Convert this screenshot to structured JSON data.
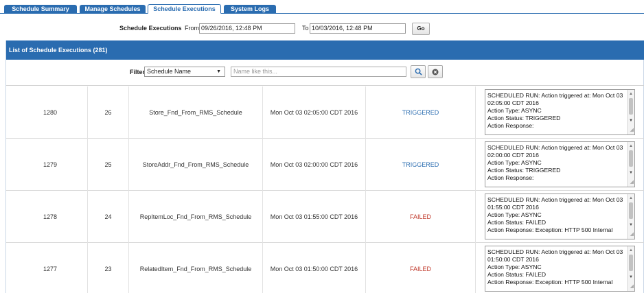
{
  "tabs": [
    {
      "label": "Schedule Summary"
    },
    {
      "label": "Manage Schedules"
    },
    {
      "label": "Schedule Executions"
    },
    {
      "label": "System Logs"
    }
  ],
  "executions": {
    "label": "Schedule Executions",
    "from_label": "From",
    "from_value": "09/26/2016, 12:48 PM",
    "to_label": "To",
    "to_value": "10/03/2016, 12:48 PM",
    "go_label": "Go"
  },
  "panel": {
    "title": "List of Schedule Executions (281)"
  },
  "filter": {
    "label": "Filter",
    "selected": "Schedule Name",
    "placeholder": "Name like this...",
    "search_icon": "search-icon",
    "clear_icon": "clear-icon"
  },
  "rows": [
    {
      "id": "1280",
      "schedule_id": "26",
      "name": "Store_Fnd_From_RMS_Schedule",
      "time": "Mon Oct 03 02:05:00 CDT 2016",
      "status": "TRIGGERED",
      "log": [
        "SCHEDULED RUN: Action triggered at: Mon Oct 03 02:05:00 CDT 2016",
        "Action Type: ASYNC",
        "Action Status: TRIGGERED",
        "Action Response:"
      ]
    },
    {
      "id": "1279",
      "schedule_id": "25",
      "name": "StoreAddr_Fnd_From_RMS_Schedule",
      "time": "Mon Oct 03 02:00:00 CDT 2016",
      "status": "TRIGGERED",
      "log": [
        "SCHEDULED RUN: Action triggered at: Mon Oct 03 02:00:00 CDT 2016",
        "Action Type: ASYNC",
        "Action Status: TRIGGERED",
        "Action Response:"
      ]
    },
    {
      "id": "1278",
      "schedule_id": "24",
      "name": "RepItemLoc_Fnd_From_RMS_Schedule",
      "time": "Mon Oct 03 01:55:00 CDT 2016",
      "status": "FAILED",
      "log": [
        "SCHEDULED RUN: Action triggered at: Mon Oct 03 01:55:00 CDT 2016",
        "Action Type: ASYNC",
        "Action Status: FAILED",
        "Action Response: Exception: HTTP 500 Internal"
      ]
    },
    {
      "id": "1277",
      "schedule_id": "23",
      "name": "RelatedItem_Fnd_From_RMS_Schedule",
      "time": "Mon Oct 03 01:50:00 CDT 2016",
      "status": "FAILED",
      "log": [
        "SCHEDULED RUN: Action triggered at: Mon Oct 03 01:50:00 CDT 2016",
        "Action Type: ASYNC",
        "Action Status: FAILED",
        "Action Response: Exception: HTTP 500 Internal"
      ]
    }
  ],
  "colors": {
    "accent": "#2a6cb0",
    "triggered": "#2a6cb0",
    "failed": "#c0392b"
  }
}
